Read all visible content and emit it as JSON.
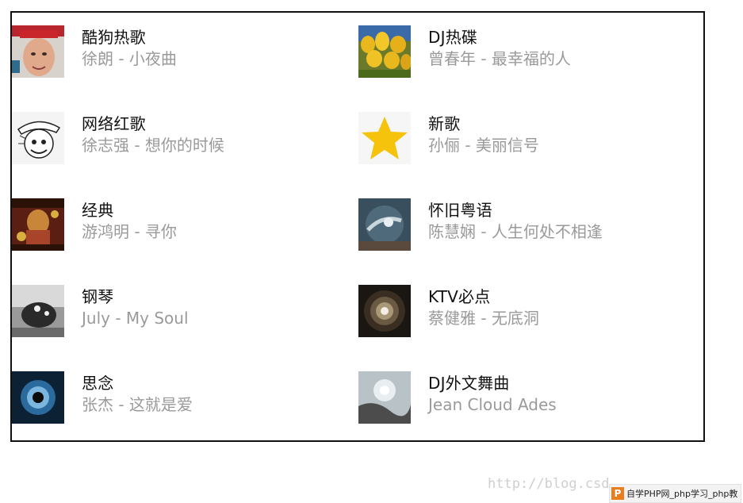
{
  "playlists": [
    {
      "title": "酷狗热歌",
      "subtitle": "徐朗 - 小夜曲",
      "icon": "cover-avatar"
    },
    {
      "title": "DJ热碟",
      "subtitle": "曾春年 - 最幸福的人",
      "icon": "cover-tulips"
    },
    {
      "title": "网络红歌",
      "subtitle": "徐志强 - 想你的时候",
      "icon": "cover-sketch"
    },
    {
      "title": "新歌",
      "subtitle": "孙俪 - 美丽信号",
      "icon": "star-icon"
    },
    {
      "title": "经典",
      "subtitle": "游鸿明 - 寻你",
      "icon": "cover-classic"
    },
    {
      "title": "怀旧粤语",
      "subtitle": "陈慧娴 - 人生何处不相逢",
      "icon": "cover-swirl"
    },
    {
      "title": "钢琴",
      "subtitle": "July - My Soul",
      "icon": "cover-piano"
    },
    {
      "title": "KTV必点",
      "subtitle": "蔡健雅 - 无底洞",
      "icon": "cover-tunnel"
    },
    {
      "title": "思念",
      "subtitle": "张杰 - 这就是爱",
      "icon": "cover-eye"
    },
    {
      "title": "DJ外文舞曲",
      "subtitle": "Jean Cloud Ades",
      "icon": "cover-light"
    }
  ],
  "watermark": "http://blog.csd",
  "badge": {
    "logo": "P",
    "text": "自学PHP网_php学习_php教"
  }
}
